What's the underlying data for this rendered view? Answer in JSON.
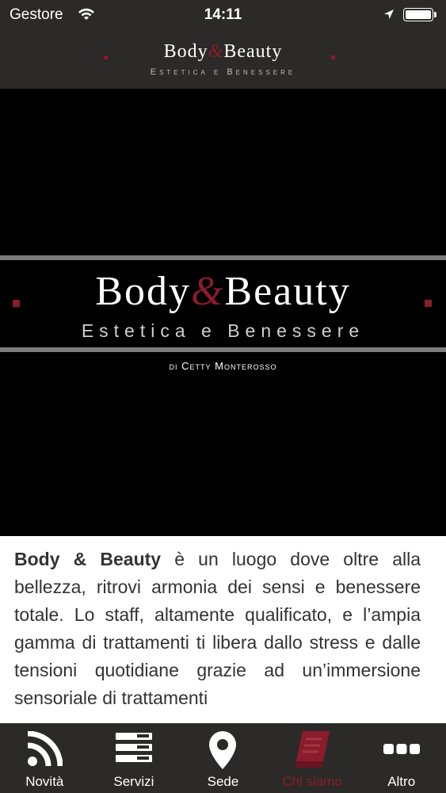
{
  "status_bar": {
    "carrier": "Gestore",
    "time": "14:11"
  },
  "header": {
    "title_left": "Body",
    "title_amp": "&",
    "title_right": "Beauty",
    "subtitle": "Estetica e Benessere"
  },
  "hero": {
    "title_left": "Body",
    "title_amp": "&",
    "title_right": "Beauty",
    "subtitle": "Estetica e Benessere",
    "credit": "di Cetty Monterosso"
  },
  "content": {
    "brand": "Body & Beauty",
    "text": " è un luogo dove oltre alla bellezza, ritrovi armonia dei sensi e benessere totale. Lo staff, altamente qualificato, e l’ampia gamma di trattamenti ti libera dallo stress e dalle tensioni quotidiane grazie ad un’immersione sensoriale di trattamenti"
  },
  "tabs": [
    {
      "label": "Novità",
      "icon": "rss-icon"
    },
    {
      "label": "Servizi",
      "icon": "list-icon"
    },
    {
      "label": "Sede",
      "icon": "map-pin-icon"
    },
    {
      "label": "Chi siamo",
      "icon": "book-icon",
      "active": true
    },
    {
      "label": "Altro",
      "icon": "more-icon"
    }
  ],
  "colors": {
    "accent": "#8a1c2b",
    "bar_bg": "#2b2a28"
  }
}
